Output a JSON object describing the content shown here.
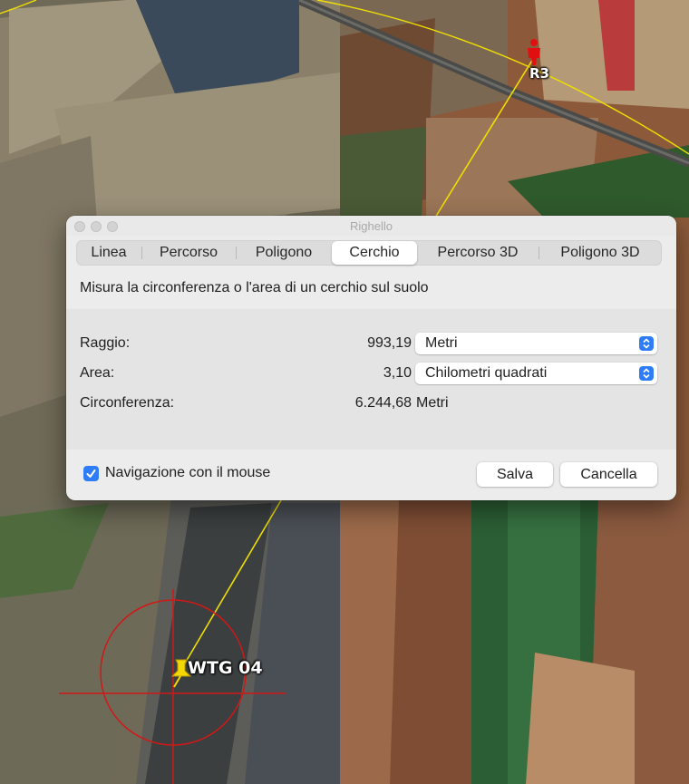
{
  "map": {
    "labels": {
      "r3": "R3",
      "wtg": "WTG 04"
    },
    "colors": {
      "measure_line": "#f0e000",
      "circle": "#d01818",
      "pushpin": "#f5d800",
      "person_marker": "#e01010"
    },
    "icons": [
      "person-marker-icon",
      "pushpin-icon"
    ]
  },
  "dialog": {
    "title": "Righello",
    "tabs": [
      {
        "label": "Linea",
        "selected": false
      },
      {
        "label": "Percorso",
        "selected": false
      },
      {
        "label": "Poligono",
        "selected": false
      },
      {
        "label": "Cerchio",
        "selected": true
      },
      {
        "label": "Percorso 3D",
        "selected": false
      },
      {
        "label": "Poligono 3D",
        "selected": false
      }
    ],
    "description": "Misura la circonferenza o l'area di un cerchio sul suolo",
    "rows": {
      "radius": {
        "label": "Raggio:",
        "value": "993,19",
        "unit": "Metri"
      },
      "area": {
        "label": "Area:",
        "value": "3,10",
        "unit": "Chilometri quadrati"
      },
      "circumference": {
        "label": "Circonferenza:",
        "value": "6.244,68",
        "unit": "Metri"
      }
    },
    "mouse_navigation": {
      "label": "Navigazione con il mouse",
      "checked": true
    },
    "buttons": {
      "save": "Salva",
      "cancel": "Cancella"
    },
    "accent_color": "#2f7df6"
  }
}
